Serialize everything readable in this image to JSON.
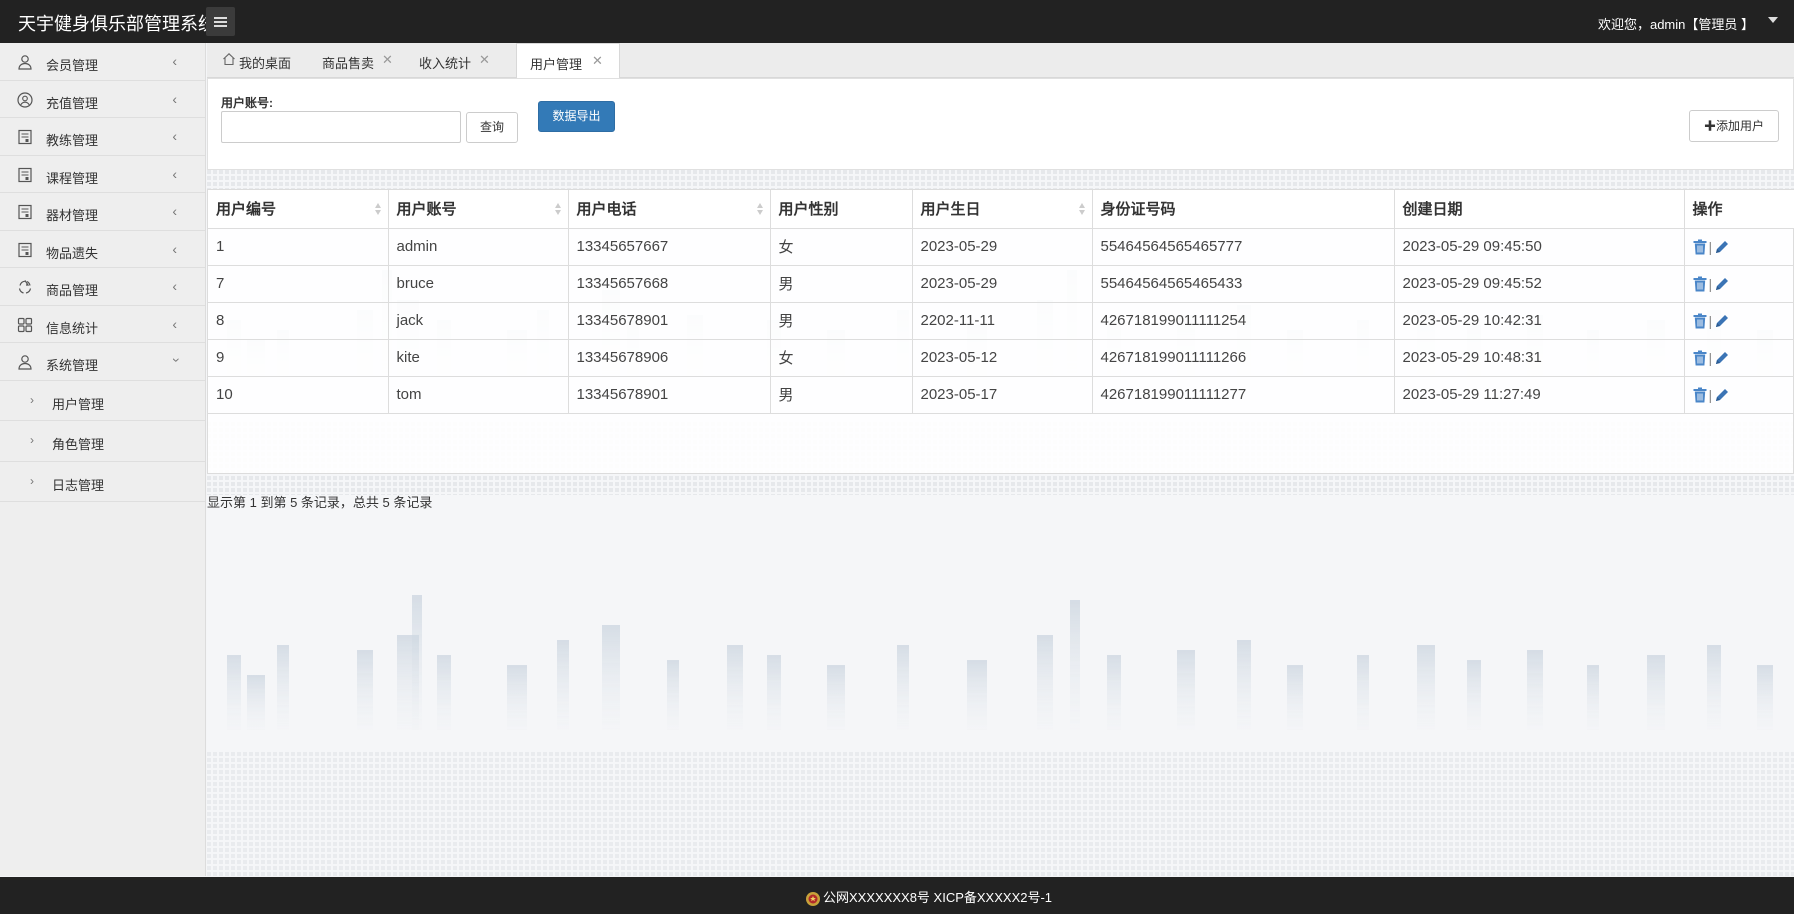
{
  "header": {
    "brand": "天宇健身俱乐部管理系统",
    "welcome": "欢迎您，admin【管理员 】"
  },
  "sidebar": {
    "items": [
      {
        "label": "会员管理",
        "icon": "user-icon"
      },
      {
        "label": "充值管理",
        "icon": "user-circle-icon"
      },
      {
        "label": "教练管理",
        "icon": "document-icon"
      },
      {
        "label": "课程管理",
        "icon": "document-icon"
      },
      {
        "label": "器材管理",
        "icon": "document-icon"
      },
      {
        "label": "物品遗失",
        "icon": "document-icon"
      },
      {
        "label": "商品管理",
        "icon": "recycle-icon"
      },
      {
        "label": "信息统计",
        "icon": "grid-icon"
      },
      {
        "label": "系统管理",
        "icon": "user-icon"
      }
    ],
    "sub_items": [
      {
        "label": "用户管理"
      },
      {
        "label": "角色管理"
      },
      {
        "label": "日志管理"
      }
    ]
  },
  "tabs": [
    {
      "label": "我的桌面",
      "icon": "home-icon"
    },
    {
      "label": "商品售卖"
    },
    {
      "label": "收入统计"
    },
    {
      "label": "用户管理",
      "active": true
    }
  ],
  "search": {
    "label": "用户账号:",
    "value": "",
    "query_button": "查询",
    "export_button": "数据导出",
    "add_button": "✚添加用户"
  },
  "table": {
    "headers": [
      "用户编号",
      "用户账号",
      "用户电话",
      "用户性别",
      "用户生日",
      "身份证号码",
      "创建日期",
      "操作"
    ],
    "rows": [
      [
        "1",
        "admin",
        "13345657667",
        "女",
        "2023-05-29",
        "55464564565465777",
        "2023-05-29 09:45:50"
      ],
      [
        "7",
        "bruce",
        "13345657668",
        "男",
        "2023-05-29",
        "55464564565465433",
        "2023-05-29 09:45:52"
      ],
      [
        "8",
        "jack",
        "13345678901",
        "男",
        "2202-11-11",
        "426718199011111254",
        "2023-05-29 10:42:31"
      ],
      [
        "9",
        "kite",
        "13345678906",
        "女",
        "2023-05-12",
        "426718199011111266",
        "2023-05-29 10:48:31"
      ],
      [
        "10",
        "tom",
        "13345678901",
        "男",
        "2023-05-17",
        "426718199011111277",
        "2023-05-29 11:27:49"
      ]
    ],
    "op_separator": "|"
  },
  "pagination": {
    "info": "显示第 1 到第 5 条记录，总共 5 条记录"
  },
  "footer": {
    "text": "公网XXXXXXX8号 XICP备XXXXX2号-1"
  },
  "colors": {
    "header_bg": "#222222",
    "primary": "#337ab7",
    "trash": "#4a86c8",
    "edit": "#3b74b5"
  }
}
